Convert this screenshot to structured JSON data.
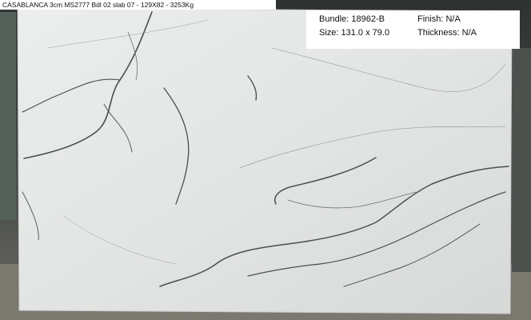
{
  "photo": {
    "caption": "CASABLANCA 3cm MS2777 Bdl 02 slab 07 - 129X82 - 3253Kg",
    "slab_color": "#e6e8e7",
    "vein_color": "#4a4e52"
  },
  "info": {
    "bundle": "Bundle: 18962-B",
    "size": "Size: 131.0 x 79.0",
    "finish": "Finish: N/A",
    "thickness": "Thickness: N/A"
  }
}
